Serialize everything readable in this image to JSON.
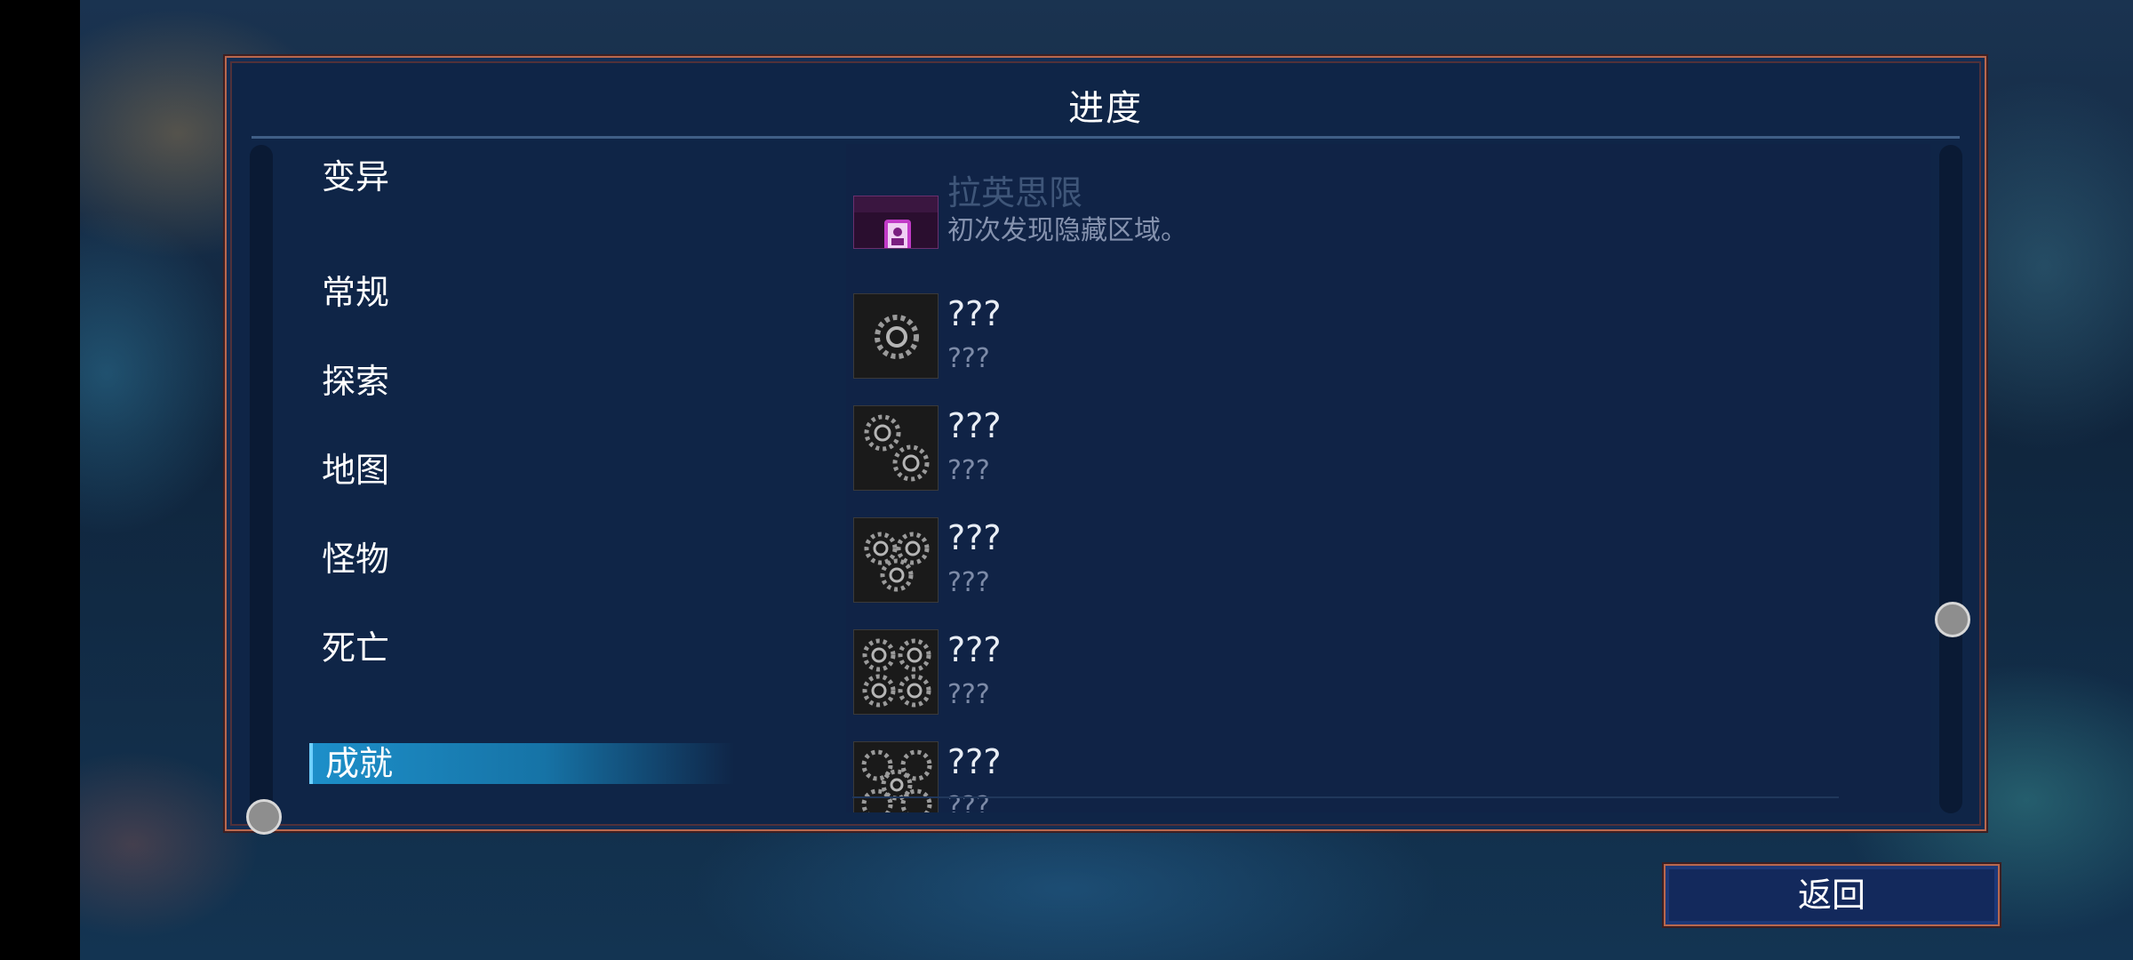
{
  "panel": {
    "title": "进度"
  },
  "categories": [
    {
      "label": "变异",
      "active": false
    },
    {
      "label": "常规",
      "active": false
    },
    {
      "label": "探索",
      "active": false
    },
    {
      "label": "地图",
      "active": false
    },
    {
      "label": "怪物",
      "active": false
    },
    {
      "label": "死亡",
      "active": false
    },
    {
      "label": "成就",
      "active": true
    }
  ],
  "achievements": [
    {
      "title": "拉英思限",
      "desc": "初次发现隐藏区域。",
      "icon": "portrait-icon"
    },
    {
      "title": "???",
      "desc": "???",
      "icon": "gear-1-icon"
    },
    {
      "title": "???",
      "desc": "???",
      "icon": "gear-2-icon"
    },
    {
      "title": "???",
      "desc": "???",
      "icon": "gear-3-icon"
    },
    {
      "title": "???",
      "desc": "???",
      "icon": "gear-4-icon"
    },
    {
      "title": "???",
      "desc": "???",
      "icon": "gear-5-icon"
    }
  ],
  "footer": {
    "back_label": "返回"
  },
  "colors": {
    "accent": "#1d8fc9",
    "frame": "#b8684f",
    "panel": "#0f2547"
  }
}
